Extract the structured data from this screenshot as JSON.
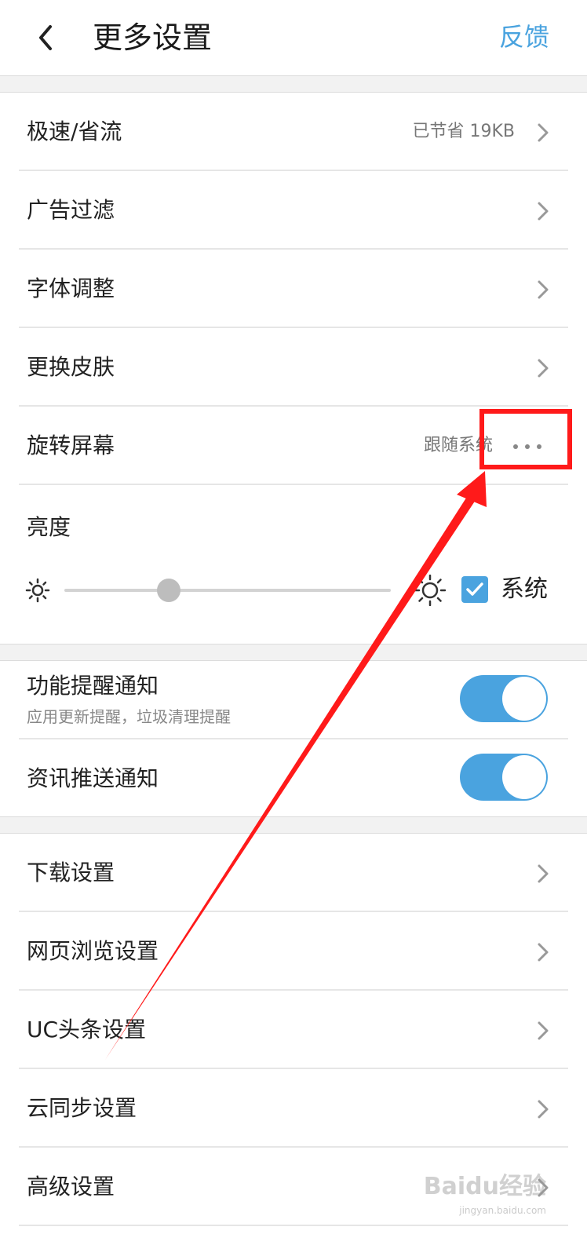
{
  "header": {
    "back_icon": "chevron-left-icon",
    "title": "更多设置",
    "feedback": "反馈"
  },
  "groups": {
    "general": [
      {
        "label": "极速/省流",
        "value": "已节省 19KB",
        "icon": "chevron-right-icon"
      },
      {
        "label": "广告过滤",
        "value": "",
        "icon": "chevron-right-icon"
      },
      {
        "label": "字体调整",
        "value": "",
        "icon": "chevron-right-icon"
      },
      {
        "label": "更换皮肤",
        "value": "",
        "icon": "chevron-right-icon"
      },
      {
        "label": "旋转屏幕",
        "value": "跟随系统",
        "icon": "more-dots-icon"
      }
    ],
    "brightness": {
      "label": "亮度",
      "level": 0.32,
      "system_checked": true,
      "system_label": "系统"
    },
    "notifications": [
      {
        "title": "功能提醒通知",
        "subtitle": "应用更新提醒，垃圾清理提醒",
        "enabled": true
      },
      {
        "title": "资讯推送通知",
        "subtitle": "",
        "enabled": true
      }
    ],
    "advanced": [
      {
        "label": "下载设置",
        "icon": "chevron-right-icon"
      },
      {
        "label": "网页浏览设置",
        "icon": "chevron-right-icon"
      },
      {
        "label": "UC头条设置",
        "icon": "chevron-right-icon"
      },
      {
        "label": "云同步设置",
        "icon": "chevron-right-icon"
      },
      {
        "label": "高级设置",
        "icon": "chevron-right-icon"
      }
    ]
  },
  "colors": {
    "accent": "#4aa3df",
    "annotation": "#ff1a1a"
  },
  "watermark": {
    "text": "Baidu经验",
    "url": "jingyan.baidu.com"
  }
}
